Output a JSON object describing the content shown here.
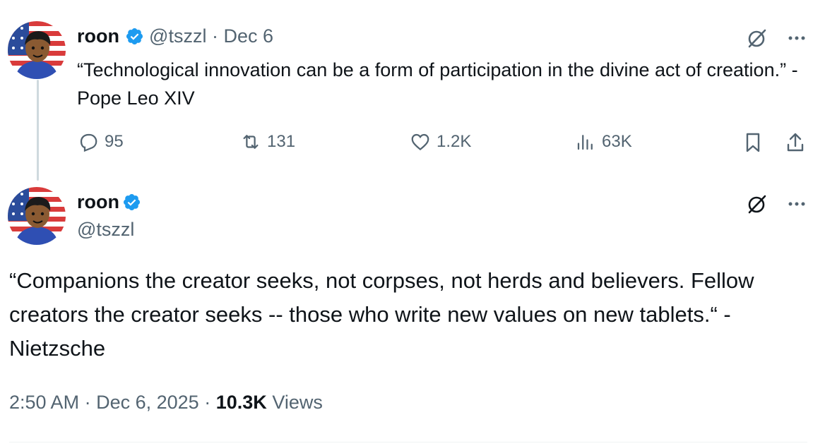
{
  "thread": {
    "parent": {
      "author_name": "roon",
      "handle": "@tszzl",
      "separator": "·",
      "date": "Dec 6",
      "text": "“Technological innovation can be a form of participation in the divine act of creation.” - Pope Leo XIV",
      "actions": {
        "replies": "95",
        "reposts": "131",
        "likes": "1.2K",
        "views": "63K"
      }
    },
    "main": {
      "author_name": "roon",
      "handle": "@tszzl",
      "text": "“Companions the creator seeks, not corpses, not herds and believers. Fellow creators the creator seeks -- those who write new values on new tablets.“ - Nietzsche",
      "time": "2:50 AM",
      "date": "Dec 6, 2025",
      "separator": "·",
      "views_count": "10.3K",
      "views_label": "Views"
    }
  },
  "icons": {
    "verified": "verified-badge-icon",
    "grok": "grok-icon",
    "more": "more-icon",
    "reply": "reply-icon",
    "repost": "repost-icon",
    "like": "like-icon",
    "views": "views-icon",
    "bookmark": "bookmark-icon",
    "share": "share-icon"
  },
  "colors": {
    "text": "#0f1419",
    "muted": "#536471",
    "verified": "#1d9bf0",
    "thread_line": "#cfd9de"
  }
}
